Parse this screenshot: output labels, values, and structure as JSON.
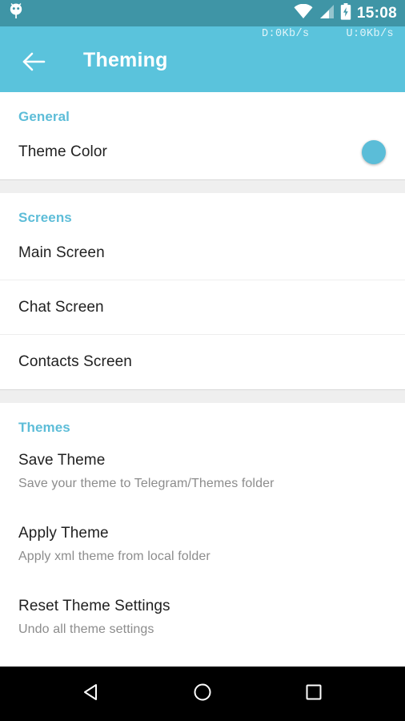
{
  "status_bar": {
    "background": "#3f95a6",
    "notification_icon": "android-robot-icon",
    "wifi_icon": "wifi-icon",
    "signal_icon": "cell-signal-icon",
    "battery_icon": "battery-charging-icon",
    "time": "15:08"
  },
  "app_bar": {
    "background": "#5ac3dc",
    "title": "Theming",
    "back_icon": "back-arrow-icon",
    "download_speed": "D:0Kb/s",
    "upload_speed": "U:0Kb/s"
  },
  "sections": [
    {
      "header": "General",
      "rows": [
        {
          "title": "Theme Color",
          "subtitle": null,
          "swatch_color": "#5bbdd8",
          "divider": false
        }
      ]
    },
    {
      "header": "Screens",
      "rows": [
        {
          "title": "Main Screen",
          "subtitle": null,
          "divider": true
        },
        {
          "title": "Chat Screen",
          "subtitle": null,
          "divider": true
        },
        {
          "title": "Contacts Screen",
          "subtitle": null,
          "divider": false
        }
      ]
    },
    {
      "header": "Themes",
      "rows": [
        {
          "title": "Save Theme",
          "subtitle": "Save your theme to Telegram/Themes folder",
          "divider": false
        },
        {
          "title": "Apply Theme",
          "subtitle": "Apply xml theme from local folder",
          "divider": false
        },
        {
          "title": "Reset Theme Settings",
          "subtitle": "Undo all theme settings",
          "divider": false
        }
      ]
    }
  ],
  "section_header_color": "#5dbdd8",
  "nav_bar": {
    "background": "#000000",
    "back_icon": "nav-back-triangle-icon",
    "home_icon": "nav-home-circle-icon",
    "recents_icon": "nav-recents-square-icon"
  }
}
